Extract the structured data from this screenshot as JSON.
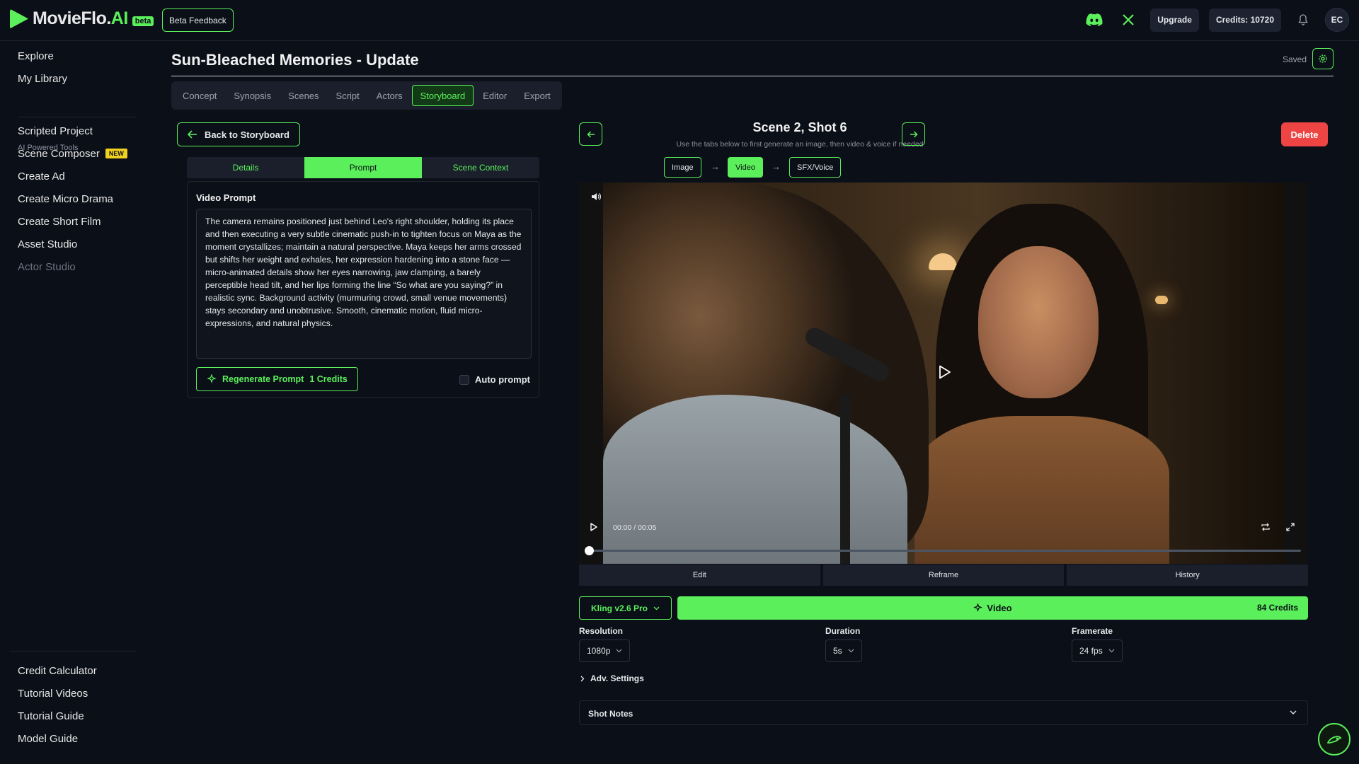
{
  "brand": {
    "name_main": "MovieFlo.",
    "name_accent": "AI",
    "tag": "beta"
  },
  "header": {
    "beta_feedback": "Beta Feedback",
    "upgrade": "Upgrade",
    "credits": "Credits: 10720",
    "avatar_initials": "EC",
    "icons": [
      "discord-icon",
      "x-icon",
      "bell-icon"
    ]
  },
  "sidebar": {
    "top_items": [
      "Explore",
      "My Library"
    ],
    "section_label": "AI Powered Tools",
    "tools": [
      {
        "label": "Scripted Project"
      },
      {
        "label": "Scene Composer",
        "badge": "NEW"
      },
      {
        "label": "Create Ad"
      },
      {
        "label": "Create Micro Drama"
      },
      {
        "label": "Create Short Film"
      },
      {
        "label": "Asset Studio"
      },
      {
        "label": "Actor Studio",
        "disabled": true
      }
    ],
    "bottom_items": [
      "Credit Calculator",
      "Tutorial Videos",
      "Tutorial Guide",
      "Model Guide"
    ]
  },
  "project": {
    "title": "Sun-Bleached Memories - Update",
    "status": "Saved"
  },
  "tabs": [
    "Concept",
    "Synopsis",
    "Scenes",
    "Script",
    "Actors",
    "Storyboard",
    "Editor",
    "Export"
  ],
  "active_tab": "Storyboard",
  "left_panel": {
    "back_button": "Back to Storyboard",
    "subtabs": [
      "Details",
      "Prompt",
      "Scene Context"
    ],
    "active_subtab": "Prompt",
    "prompt_label": "Video Prompt",
    "prompt_text": "The camera remains positioned just behind Leo's right shoulder, holding its place and then executing a very subtle cinematic push-in to tighten focus on Maya as the moment crystallizes; maintain a natural perspective. Maya keeps her arms crossed but shifts her weight and exhales, her expression hardening into a stone face — micro-animated details show her eyes narrowing, jaw clamping, a barely perceptible head tilt, and her lips forming the line “So what are you saying?” in realistic sync. Background activity (murmuring crowd, small venue movements) stays secondary and unobtrusive. Smooth, cinematic motion, fluid micro-expressions, and natural physics.",
    "regenerate_label": "Regenerate Prompt",
    "regenerate_cost": "1 Credits",
    "auto_prompt": "Auto prompt",
    "auto_prompt_checked": false
  },
  "shot": {
    "title": "Scene 2, Shot 6",
    "subtitle": "Use the tabs below to first generate an image, then video & voice if needed",
    "delete": "Delete",
    "steps": [
      "Image",
      "Video",
      "SFX/Voice"
    ],
    "active_step": "Video"
  },
  "player": {
    "time": "00:00 / 00:05",
    "progress": 0,
    "tabs": [
      "Edit",
      "Reframe",
      "History"
    ]
  },
  "generate": {
    "model": "Kling v2.6 Pro",
    "button": "Video",
    "cost": "84 Credits",
    "resolution_label": "Resolution",
    "resolution": "1080p",
    "duration_label": "Duration",
    "duration": "5s",
    "framerate_label": "Framerate",
    "framerate": "24 fps",
    "adv_settings": "Adv. Settings",
    "shot_notes": "Shot Notes"
  },
  "colors": {
    "accent": "#5bf05b",
    "danger": "#ef4444",
    "background": "#0b0f17",
    "badge": "#f0d020"
  }
}
